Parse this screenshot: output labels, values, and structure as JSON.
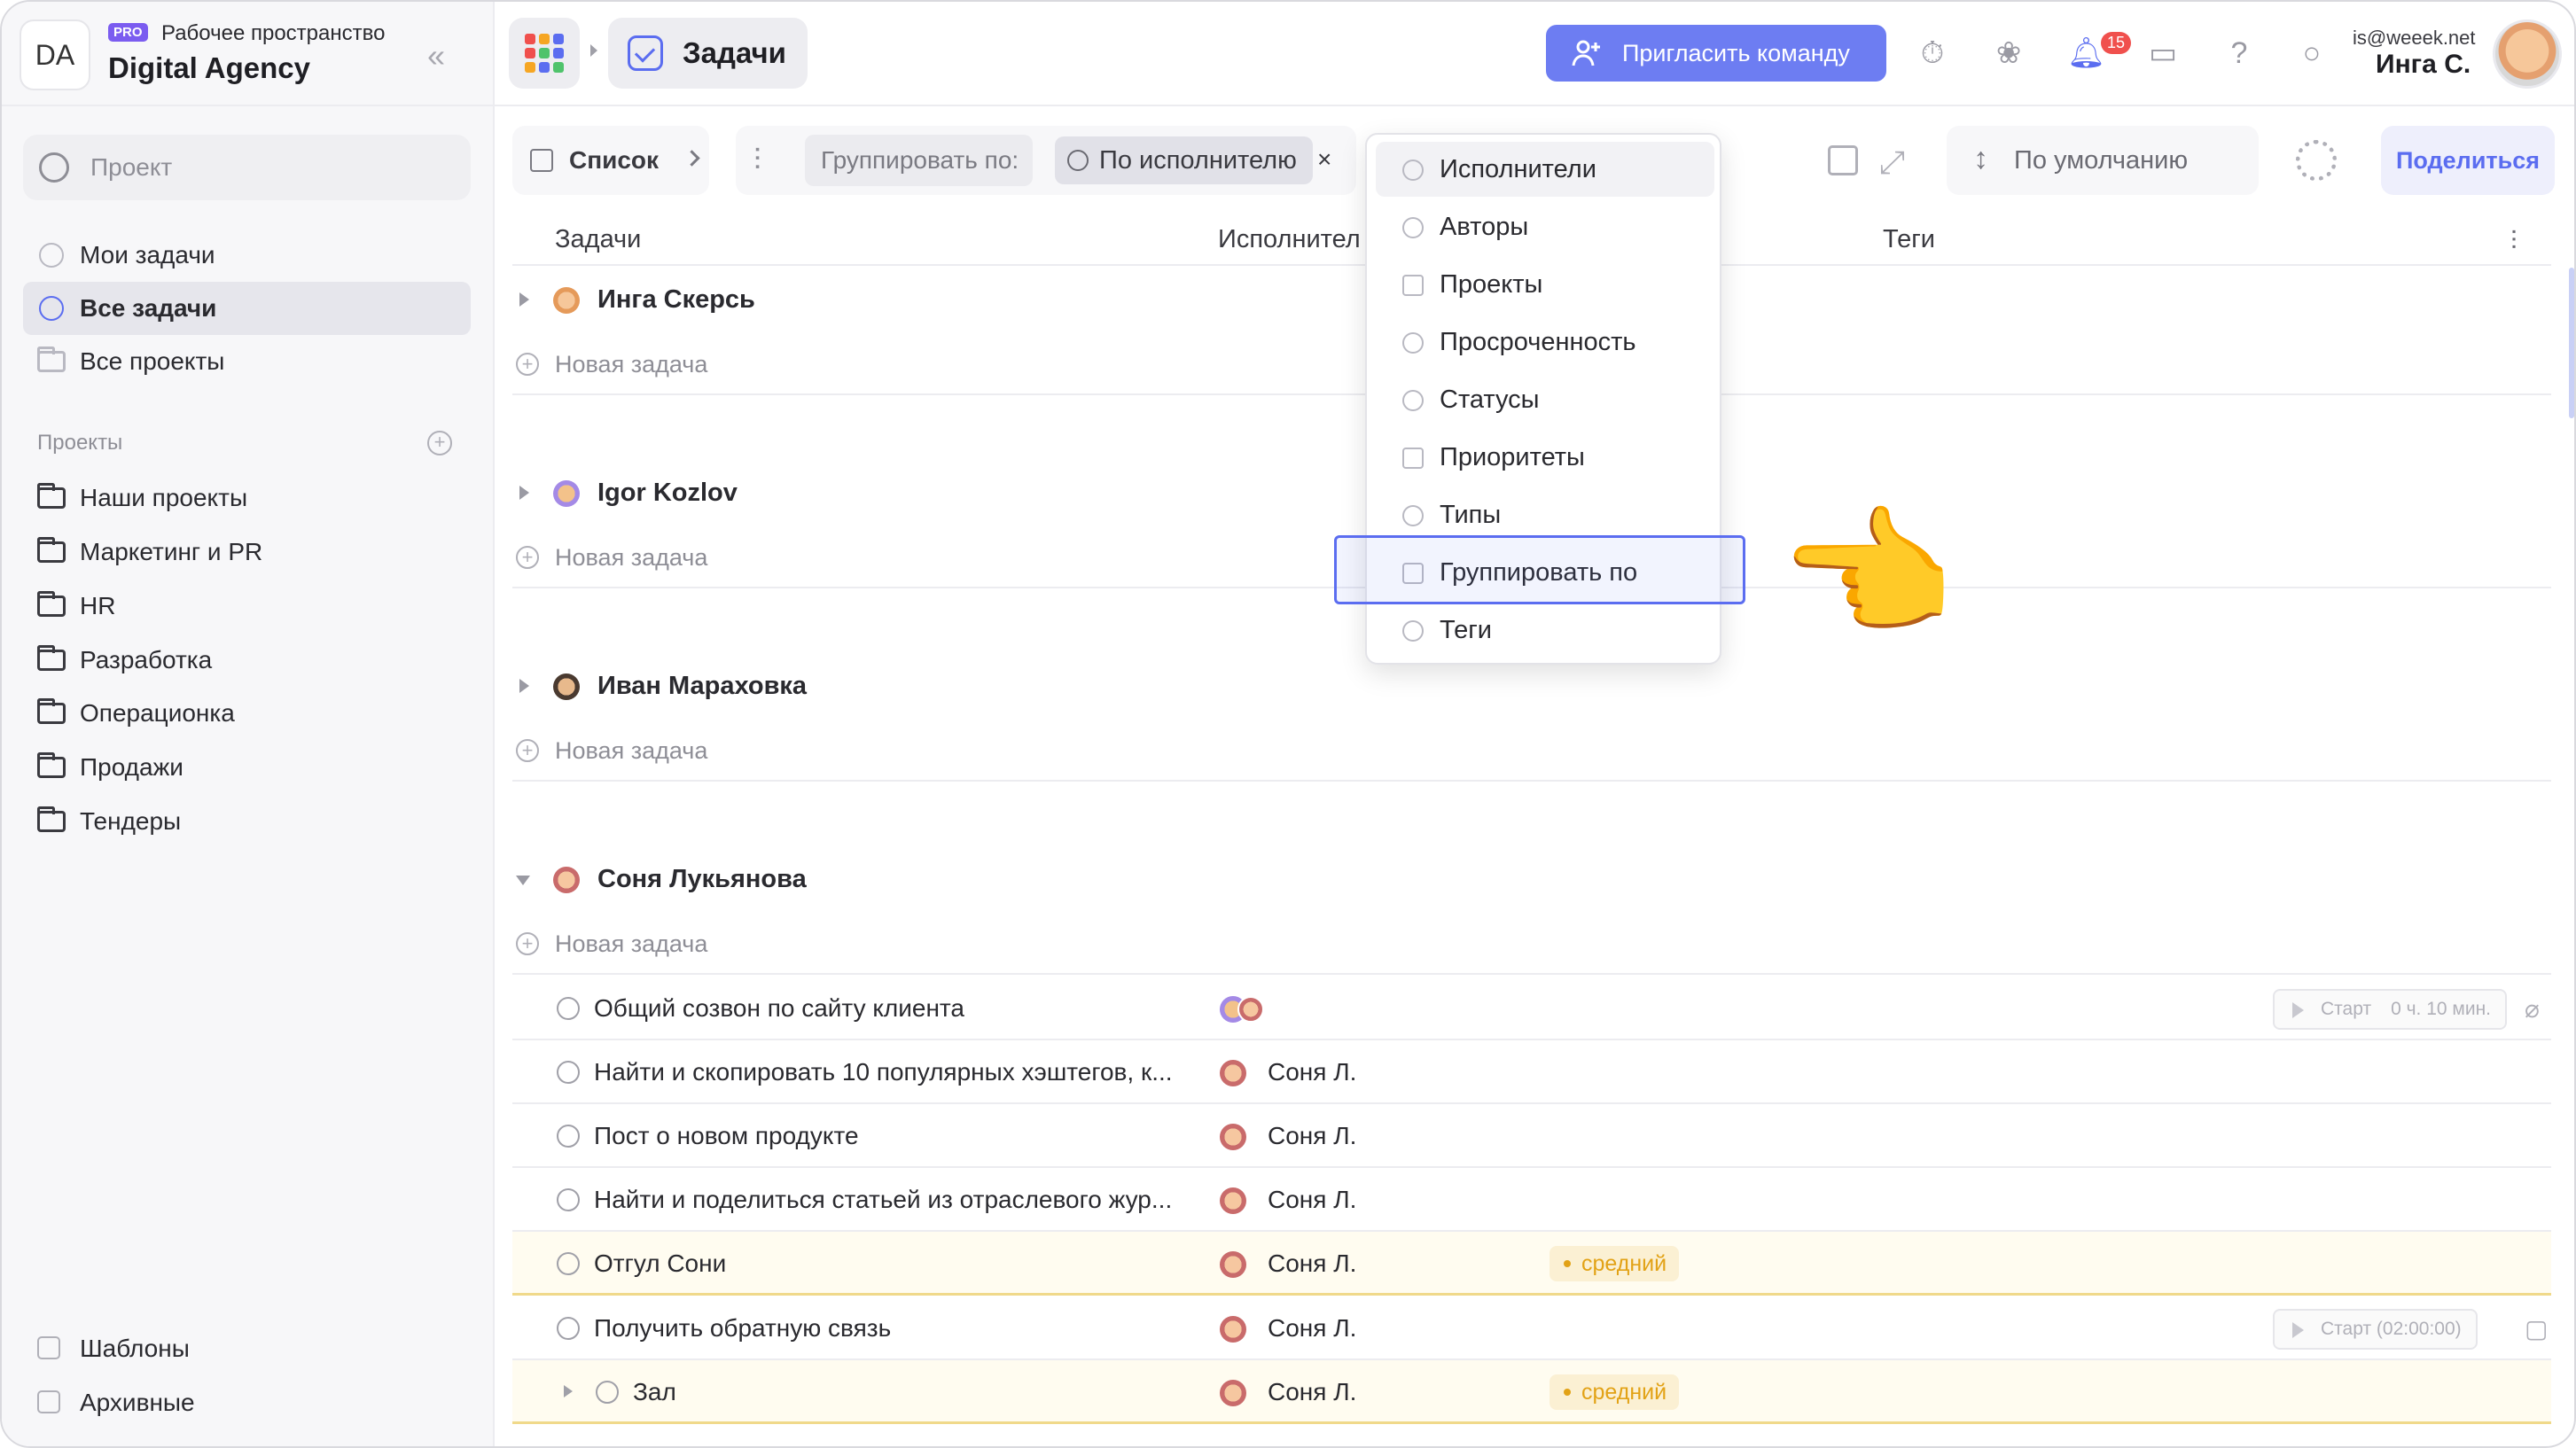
{
  "workspace": {
    "avatar_initials": "DA",
    "plan_badge": "PRO",
    "subtitle": "Рабочее пространство",
    "name": "Digital Agency"
  },
  "sidebar": {
    "search_placeholder": "Проект",
    "main_items": [
      {
        "label": "Мои задачи",
        "active": false
      },
      {
        "label": "Все задачи",
        "active": true
      },
      {
        "label": "Все проекты",
        "active": false
      }
    ],
    "projects_title": "Проекты",
    "projects": [
      {
        "label": "Наши проекты"
      },
      {
        "label": "Маркетинг и PR"
      },
      {
        "label": "HR"
      },
      {
        "label": "Разработка"
      },
      {
        "label": "Операционка"
      },
      {
        "label": "Продажи"
      },
      {
        "label": "Тендеры"
      }
    ],
    "bottom_items": [
      {
        "label": "Шаблоны"
      },
      {
        "label": "Архивные"
      }
    ]
  },
  "topbar": {
    "page_title": "Задачи",
    "invite_label": "Пригласить команду",
    "notifications_count": "15",
    "user_email": "is@weeek.net",
    "user_name": "Инга С.",
    "apps_colors": [
      "#f0504d",
      "#f6a623",
      "#5b6df0",
      "#f0504d",
      "#4fc36b",
      "#5b6df0",
      "#f6a623",
      "#5b6df0",
      "#4fc36b"
    ]
  },
  "toolbar": {
    "view_label": "Список",
    "group_label": "Группировать по:",
    "group_value": "По исполнителю",
    "group_clear": "×",
    "sort_label": "По умолчанию",
    "share_label": "Поделиться"
  },
  "table": {
    "headers": {
      "tasks": "Задачи",
      "assignee": "Исполнител",
      "tags": "Теги"
    },
    "new_task_label": "Новая задача",
    "groups": [
      {
        "name": "Инга Скерсь",
        "expanded": false,
        "avatar_color": "#f3b27a"
      },
      {
        "name": "Igor Kozlov",
        "expanded": false,
        "avatar_color": "#a48ae6"
      },
      {
        "name": "Иван Мараховка",
        "expanded": false,
        "avatar_color": "#6b5a4a"
      },
      {
        "name": "Соня Лукьянова",
        "expanded": true,
        "avatar_color": "#e58a8a"
      }
    ],
    "tasks": [
      {
        "name": "Общий созвон по сайту клиента",
        "assignee": "",
        "priority": "",
        "timer": "Старт",
        "timer_extra": "0 ч. 10 мин."
      },
      {
        "name": "Найти и скопировать 10 популярных хэштегов, к...",
        "assignee": "Соня Л.",
        "priority": "",
        "timer": "",
        "timer_extra": ""
      },
      {
        "name": "Пост о новом продукте",
        "assignee": "Соня Л.",
        "priority": "",
        "timer": "",
        "timer_extra": ""
      },
      {
        "name": "Найти и поделиться статьей из отраслевого жур...",
        "assignee": "Соня Л.",
        "priority": "",
        "timer": "",
        "timer_extra": ""
      },
      {
        "name": "Отгул Сони",
        "assignee": "Соня Л.",
        "priority": "средний",
        "timer": "",
        "timer_extra": ""
      },
      {
        "name": "Получить обратную связь",
        "assignee": "Соня Л.",
        "priority": "",
        "timer": "Старт (02:00:00)",
        "timer_extra": ""
      },
      {
        "name": "Зал",
        "assignee": "Соня Л.",
        "priority": "средний",
        "timer": "",
        "timer_extra": ""
      }
    ]
  },
  "dropdown": {
    "items": [
      {
        "label": "Исполнители",
        "icon": "user-circle-icon"
      },
      {
        "label": "Авторы",
        "icon": "user-circle-icon"
      },
      {
        "label": "Проекты",
        "icon": "folder-icon"
      },
      {
        "label": "Просроченность",
        "icon": "refresh-icon"
      },
      {
        "label": "Статусы",
        "icon": "flame-icon"
      },
      {
        "label": "Приоритеты",
        "icon": "bars-icon"
      },
      {
        "label": "Типы",
        "icon": "type-icon"
      },
      {
        "label": "Группировать по",
        "icon": "list-icon"
      },
      {
        "label": "Теги",
        "icon": "tag-icon"
      }
    ],
    "highlighted": "Группировать по"
  },
  "pointer": {
    "emoji": "👈"
  }
}
